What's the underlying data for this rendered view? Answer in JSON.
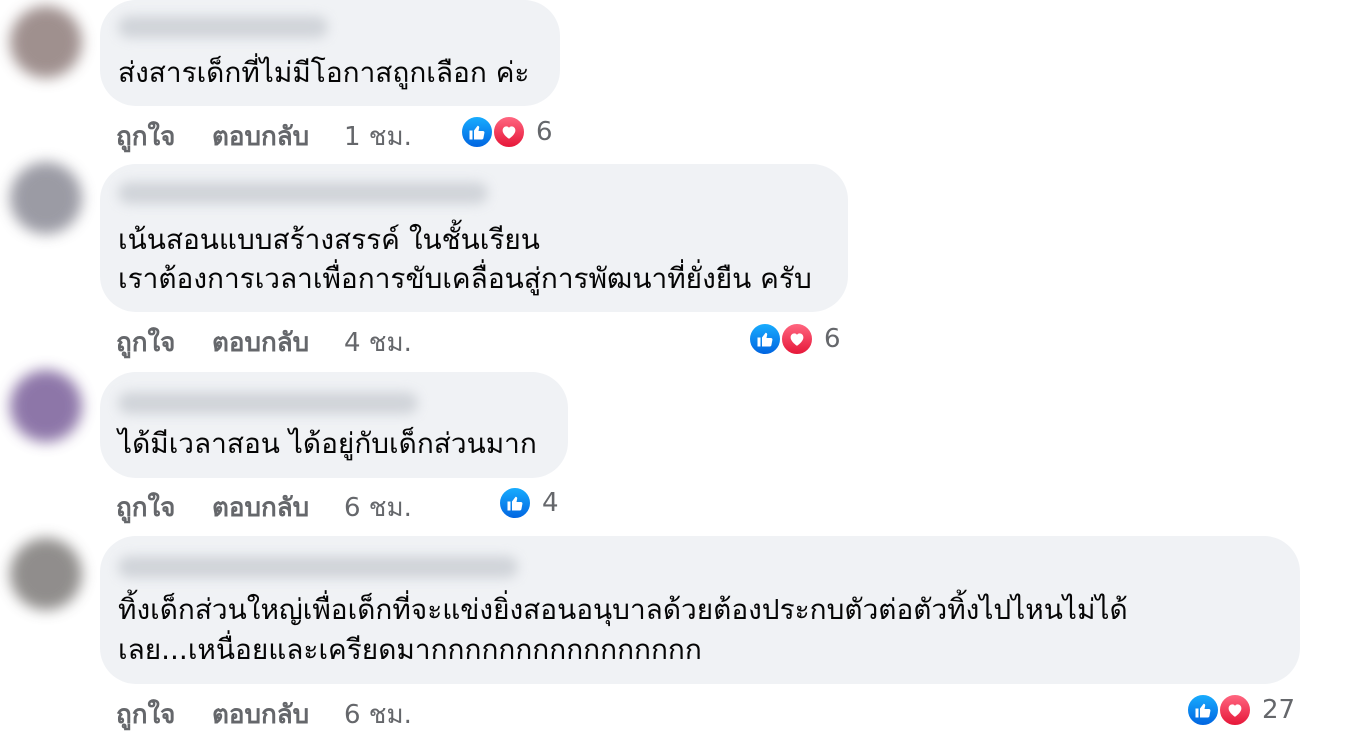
{
  "actions": {
    "like_label": "ถูกใจ",
    "reply_label": "ตอบกลับ"
  },
  "colors": {
    "bubble": "#f0f2f5",
    "meta_text": "#65676b",
    "like_blue": "#0866ff",
    "love_red": "#f33e58"
  },
  "comments": [
    {
      "avatar_color": "#8f7d7b",
      "lines": [
        "ส่งสารเด็กที่ไม่มีโอกาสถูกเลือก ค่ะ"
      ],
      "time": "1 ชม.",
      "reactions": [
        "like-icon",
        "love-icon"
      ],
      "reaction_count": "6"
    },
    {
      "avatar_color": "#8a8a95",
      "lines": [
        "เน้นสอนแบบสร้างสรรค์ ในชั้นเรียน",
        "เราต้องการเวลาเพื่อการขับเคลื่อนสู่การพัฒนาที่ยั่งยืน ครับ"
      ],
      "time": "4 ชม.",
      "reactions": [
        "like-icon",
        "love-icon"
      ],
      "reaction_count": "6"
    },
    {
      "avatar_color": "#7a5f9a",
      "lines": [
        "ได้มีเวลาสอน ได้อยู่กับเด็กส่วนมาก"
      ],
      "time": "6 ชม.",
      "reactions": [
        "like-icon"
      ],
      "reaction_count": "4"
    },
    {
      "avatar_color": "#7d7a78",
      "lines": [
        "ทิ้งเด็กส่วนใหญ่เพื่อเด็กที่จะแข่งยิ่งสอนอนุบาลด้วยต้องประกบตัวต่อตัวทิ้งไปไหนไม่ได้",
        "เลย...เหนื่อยและเครียดมากกกกกกกกกกกกกกกก"
      ],
      "time": "6 ชม.",
      "reactions": [
        "like-icon",
        "love-icon"
      ],
      "reaction_count": "27"
    }
  ]
}
